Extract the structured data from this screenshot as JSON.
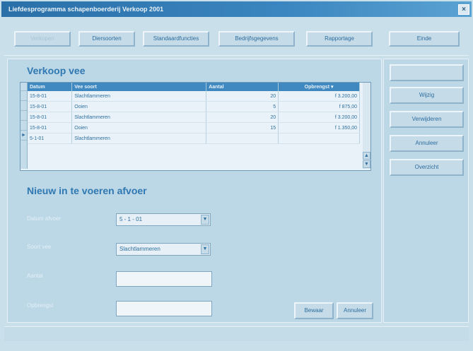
{
  "window": {
    "title": "Liefdesprogramma schapenboerderij Verkoop 2001",
    "close_label": "×"
  },
  "toolbar": {
    "btn1": "Verkopen",
    "btn2": "Diersoorten",
    "btn3": "Standaardfuncties",
    "btn4": "Bedrijfsgegevens",
    "btn5": "Rapportage",
    "btn6": "Einde"
  },
  "main": {
    "section_title": "Verkoop vee",
    "grid": {
      "columns": [
        "Datum",
        "Vee soort",
        "Aantal",
        "Opbrengst"
      ],
      "rows": [
        {
          "datum": "15-8-01",
          "soort": "Slachtlammeren",
          "aantal": "20",
          "opbrengst": "f 3.200,00"
        },
        {
          "datum": "15-8-01",
          "soort": "Ooien",
          "aantal": "5",
          "opbrengst": "f 875,00"
        },
        {
          "datum": "15-8-01",
          "soort": "Slachtlammeren",
          "aantal": "20",
          "opbrengst": "f 3.200,00"
        },
        {
          "datum": "15-8-01",
          "soort": "Ooien",
          "aantal": "15",
          "opbrengst": "f 1.350,00"
        },
        {
          "datum": "5-1-01",
          "soort": "Slachtlammeren",
          "aantal": "",
          "opbrengst": ""
        }
      ]
    },
    "form_title": "Nieuw in te voeren afvoer",
    "form": {
      "datum_label": "Datum afvoer",
      "datum_value": "5 - 1 - 01",
      "soort_label": "Soort vee",
      "soort_value": "Slachtlammeren",
      "aantal_label": "Aantal",
      "aantal_value": "",
      "opbrengst_label": "Opbrengst",
      "opbrengst_value": ""
    },
    "buttons": {
      "bewaar": "Bewaar",
      "annuleer": "Annuleer"
    }
  },
  "side": {
    "btn_top": "",
    "btn1": "Wijzig",
    "btn2": "Verwijderen",
    "btn3": "Annuleer",
    "btn4": "Overzicht"
  }
}
